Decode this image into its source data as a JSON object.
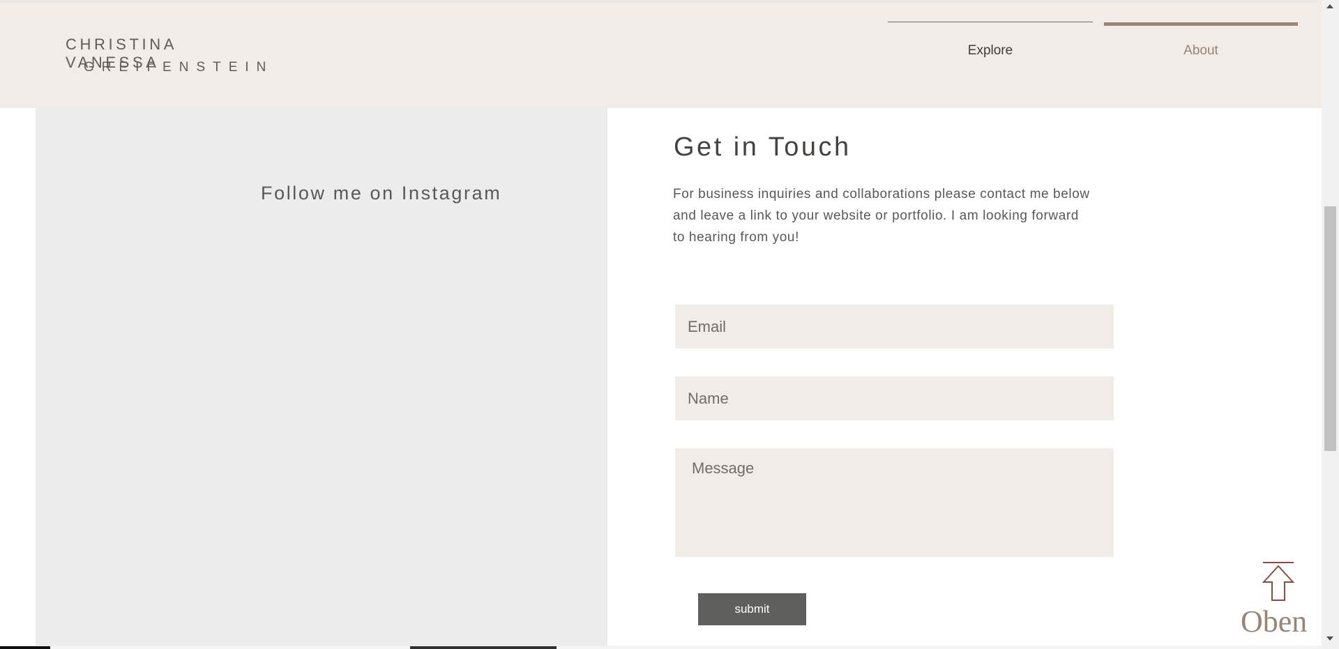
{
  "brand": {
    "line1": "CHRISTINA VANESSA",
    "line2": "GREIFENSTEIN"
  },
  "nav": {
    "explore": "Explore",
    "about": "About"
  },
  "instagram": {
    "title": "Follow me on Instagram"
  },
  "contact": {
    "title": "Get in Touch",
    "text": "For business inquiries and collaborations please contact me below and leave a link to your website or portfolio. I am looking forward to hearing from you!",
    "email_placeholder": "Email",
    "name_placeholder": "Name",
    "message_placeholder": "Message",
    "submit_label": "submit"
  },
  "scroll_top": {
    "label": "Oben",
    "icon": "arrow-up-icon",
    "color": "#8e4b3c"
  },
  "colors": {
    "header_bg": "#f1ece8",
    "accent": "#9a8474",
    "panel_bg": "#ececec",
    "button_bg": "#5f5f5d"
  }
}
